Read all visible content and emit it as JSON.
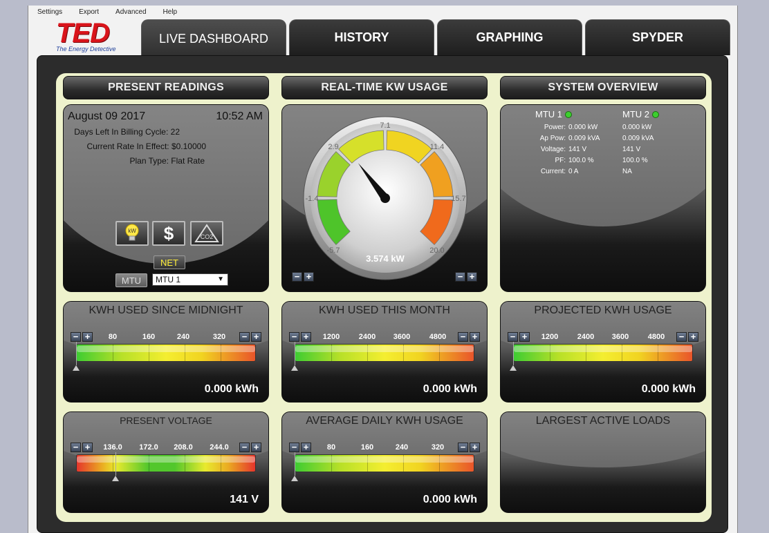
{
  "menu": [
    "Settings",
    "Export",
    "Advanced",
    "Help"
  ],
  "logo": {
    "text": "TED",
    "tagline": "The Energy Detective"
  },
  "tabs": [
    "LIVE DASHBOARD",
    "HISTORY",
    "GRAPHING",
    "SPYDER"
  ],
  "headers": {
    "present": "PRESENT READINGS",
    "realtime": "REAL-TIME KW USAGE",
    "overview": "SYSTEM OVERVIEW"
  },
  "present": {
    "date": "August 09 2017",
    "time": "10:52 AM",
    "days_left": "Days Left In Billing Cycle: 22",
    "rate": "Current Rate In Effect: $0.10000",
    "plan": "Plan Type: Flat Rate",
    "net": "NET",
    "mtu_label": "MTU",
    "mtu_select": "MTU 1",
    "icon_kw": "kW",
    "icon_dollar": "$",
    "icon_co2": "CO2"
  },
  "gauge": {
    "ticks": [
      "-5.7",
      "-1.4",
      "2.9",
      "7.1",
      "11.4",
      "15.7",
      "20.0"
    ],
    "value_label": "3.574 kW",
    "value": 3.574,
    "min": -5.7,
    "max": 20.0
  },
  "overview": {
    "mtu1": "MTU 1",
    "mtu2": "MTU 2",
    "labels": [
      "Power:",
      "Ap Pow:",
      "Voltage:",
      "PF:",
      "Current:"
    ],
    "mtu1_values": [
      "0.000 kW",
      "0.009 kVA",
      "141 V",
      "100.0 %",
      "0 A"
    ],
    "mtu2_values": [
      "0.000 kW",
      "0.009 kVA",
      "141 V",
      "100.0 %",
      "NA"
    ]
  },
  "gauges": [
    {
      "title": "KWH USED SINCE MIDNIGHT",
      "ticks": [
        "80",
        "160",
        "240",
        "320"
      ],
      "value": "0.000 kWh",
      "level": 0,
      "style": "gyr"
    },
    {
      "title": "KWH USED THIS MONTH",
      "ticks": [
        "1200",
        "2400",
        "3600",
        "4800"
      ],
      "value": "0.000 kWh",
      "level": 0,
      "style": "gyr"
    },
    {
      "title": "PROJECTED KWH USAGE",
      "ticks": [
        "1200",
        "2400",
        "3600",
        "4800"
      ],
      "value": "0.000 kWh",
      "level": 0,
      "style": "gyr"
    },
    {
      "title": "PRESENT VOLTAGE",
      "ticks": [
        "136.0",
        "172.0",
        "208.0",
        "244.0"
      ],
      "value": "141 V",
      "level": 0.22,
      "style": "ryg"
    },
    {
      "title": "AVERAGE DAILY KWH USAGE",
      "ticks": [
        "80",
        "160",
        "240",
        "320"
      ],
      "value": "0.000 kWh",
      "level": 0,
      "style": "gyr"
    },
    {
      "title": "LARGEST ACTIVE LOADS",
      "ticks": [],
      "value": "",
      "level": null,
      "style": "none"
    }
  ]
}
